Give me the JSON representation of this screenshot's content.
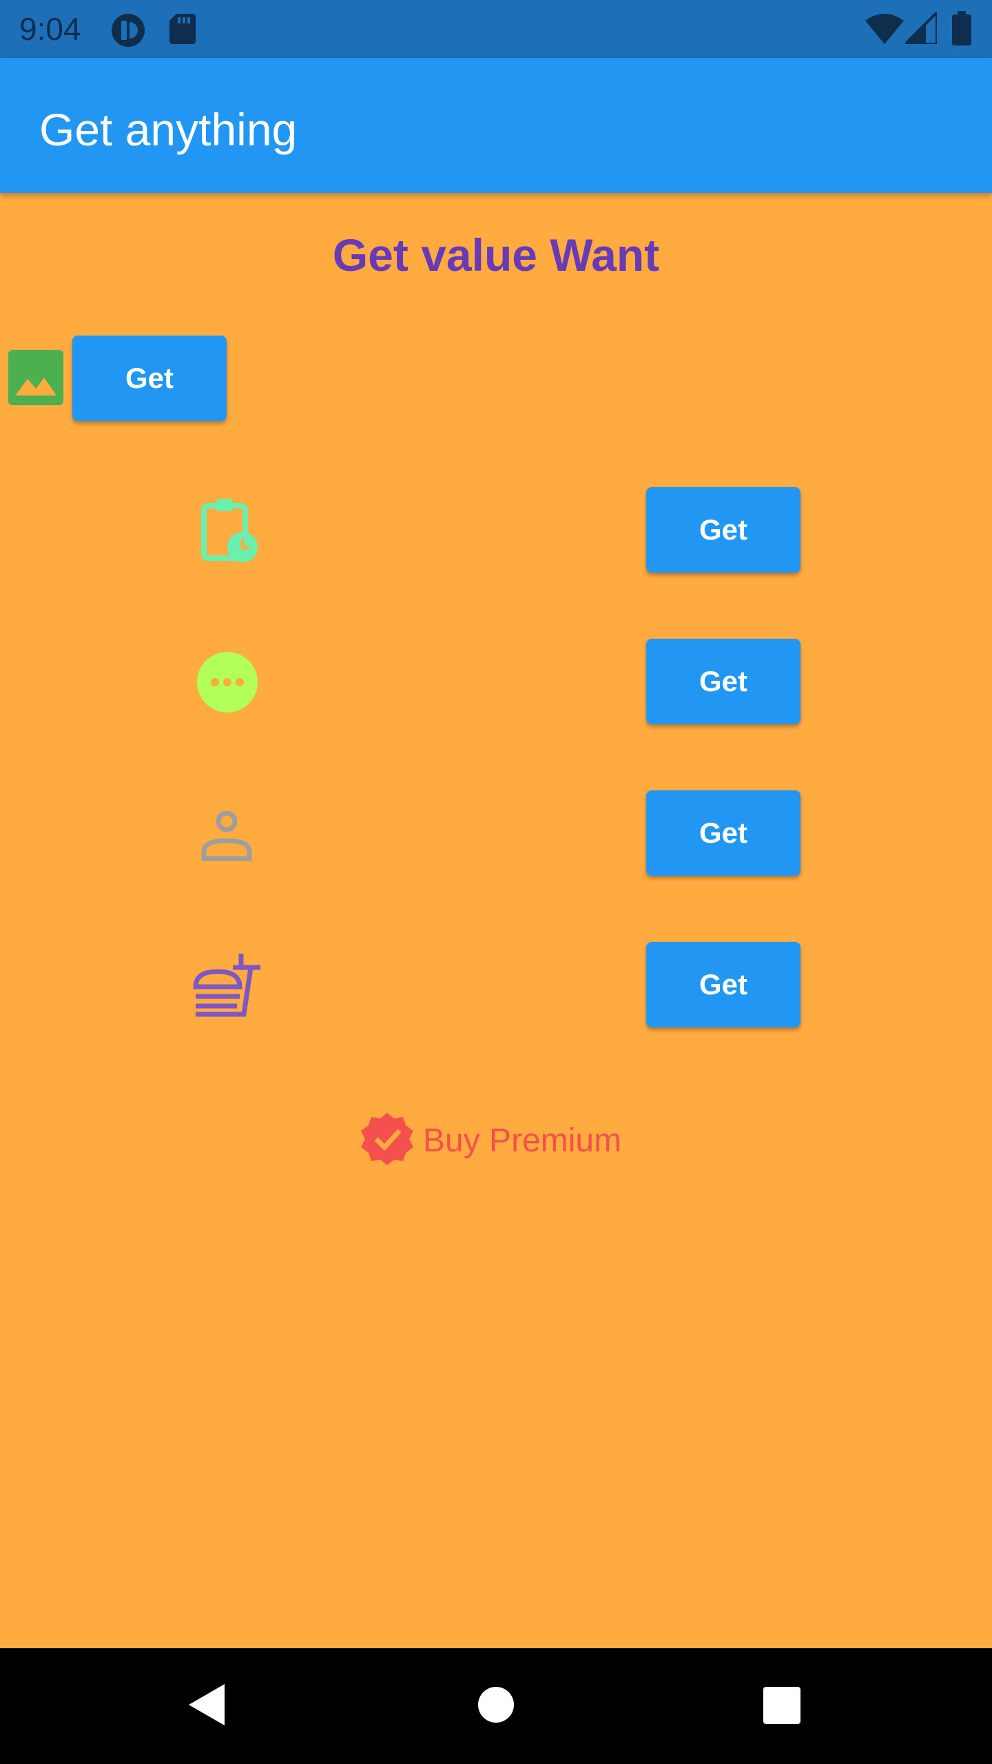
{
  "status_bar": {
    "time": "9:04",
    "icons": [
      "sync-icon",
      "sd-card-icon",
      "wifi-icon",
      "cell-signal-icon",
      "battery-icon"
    ]
  },
  "app_bar": {
    "title": "Get anything"
  },
  "main": {
    "heading": "Get value Want",
    "rows": [
      {
        "icon": "image-icon",
        "button_label": "Get"
      },
      {
        "icon": "clipboard-clock-icon",
        "button_label": "Get"
      },
      {
        "icon": "more-horiz-circle-icon",
        "button_label": "Get"
      },
      {
        "icon": "person-outline-icon",
        "button_label": "Get"
      },
      {
        "icon": "fastfood-icon",
        "button_label": "Get"
      }
    ],
    "premium": {
      "icon": "verified-badge-icon",
      "label": "Buy Premium"
    }
  },
  "nav_bar": {
    "buttons": [
      "back-icon",
      "home-icon",
      "recents-icon"
    ]
  },
  "colors": {
    "background": "#FFAB40",
    "app_bar": "#2196F3",
    "status_bar": "#1D6FB8",
    "heading": "#673AB7",
    "button": "#2196F3",
    "premium": "#F4504E"
  }
}
